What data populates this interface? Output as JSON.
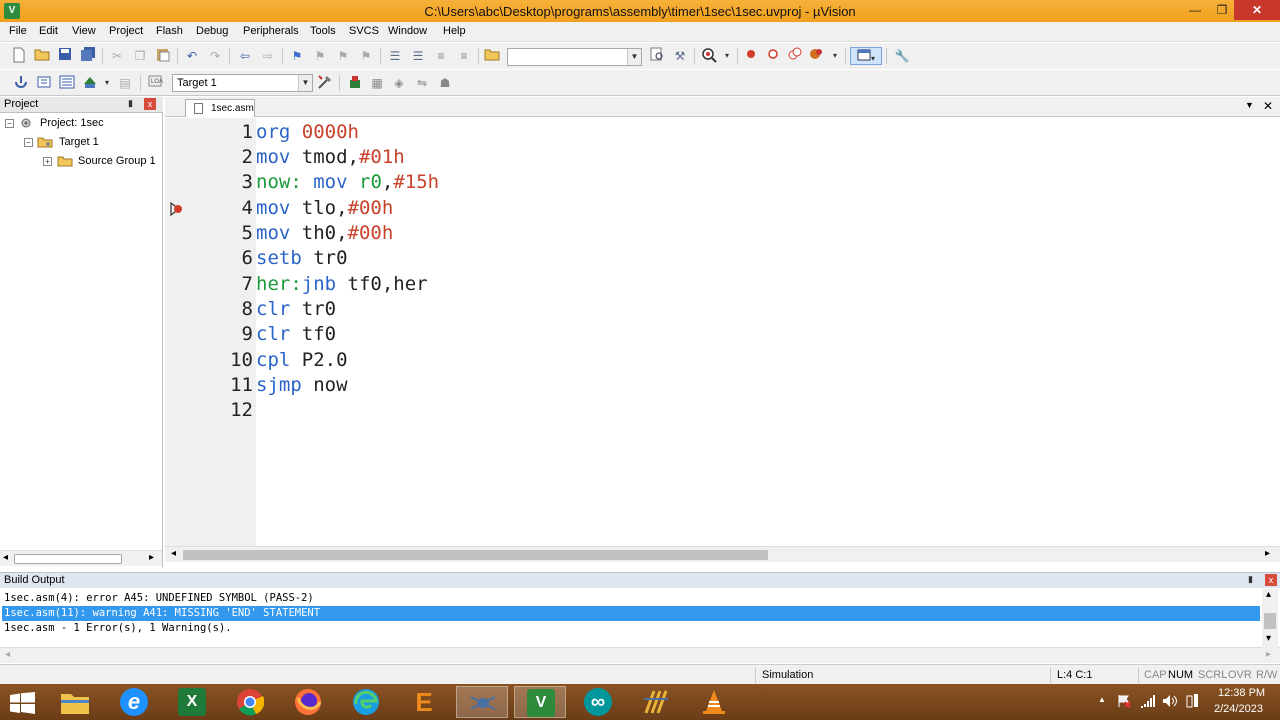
{
  "window": {
    "title": "C:\\Users\\abc\\Desktop\\programs\\assembly\\timer\\1sec\\1sec.uvproj - µVision",
    "app_icon": "V",
    "minimize": "—",
    "maximize": "❐",
    "close": "✕"
  },
  "menu": [
    "File",
    "Edit",
    "View",
    "Project",
    "Flash",
    "Debug",
    "Peripherals",
    "Tools",
    "SVCS",
    "Window",
    "Help"
  ],
  "toolbar2": {
    "target_select": "Target 1",
    "target_select_arrow": "▼"
  },
  "project_panel": {
    "title": "Project",
    "pin": "▮",
    "close": "x",
    "tree": [
      {
        "label": "Project: 1sec",
        "expander": "−",
        "icon": "project-gear-icon"
      },
      {
        "label": "Target 1",
        "expander": "−",
        "icon": "target-folder-icon"
      },
      {
        "label": "Source Group 1",
        "expander": "+",
        "icon": "folder-icon"
      }
    ],
    "scroll_left": "◂",
    "scroll_right": "▸"
  },
  "editor": {
    "tab_label": "1sec.asm",
    "dropdown": "▼",
    "close": "✕",
    "line_numbers": [
      "1",
      "2",
      "3",
      "4",
      "5",
      "6",
      "7",
      "8",
      "9",
      "10",
      "11",
      "12"
    ],
    "breakpoint_line": 4,
    "scroll_left": "◂",
    "scroll_right": "▸",
    "lines": [
      [
        {
          "t": "org",
          "c": "kw"
        },
        {
          "t": " ",
          "c": "plain"
        },
        {
          "t": "0000h",
          "c": "num"
        }
      ],
      [
        {
          "t": "mov",
          "c": "kw"
        },
        {
          "t": " tmod,",
          "c": "plain"
        },
        {
          "t": "#01h",
          "c": "num"
        }
      ],
      [
        {
          "t": "now:",
          "c": "lbl-green"
        },
        {
          "t": " ",
          "c": "plain"
        },
        {
          "t": "mov",
          "c": "kw"
        },
        {
          "t": " ",
          "c": "plain"
        },
        {
          "t": "r0",
          "c": "lbl-green"
        },
        {
          "t": ",",
          "c": "plain"
        },
        {
          "t": "#15h",
          "c": "num"
        }
      ],
      [
        {
          "t": "mov",
          "c": "kw"
        },
        {
          "t": " tlo,",
          "c": "plain"
        },
        {
          "t": "#00h",
          "c": "num"
        }
      ],
      [
        {
          "t": "mov",
          "c": "kw"
        },
        {
          "t": " th0,",
          "c": "plain"
        },
        {
          "t": "#00h",
          "c": "num"
        }
      ],
      [
        {
          "t": "setb",
          "c": "kw"
        },
        {
          "t": " tr0",
          "c": "plain"
        }
      ],
      [
        {
          "t": "her:",
          "c": "lbl-green"
        },
        {
          "t": "jnb",
          "c": "kw"
        },
        {
          "t": " tf0,her",
          "c": "plain"
        }
      ],
      [
        {
          "t": "clr",
          "c": "kw"
        },
        {
          "t": " tr0",
          "c": "plain"
        }
      ],
      [
        {
          "t": "clr",
          "c": "kw"
        },
        {
          "t": " tf0",
          "c": "plain"
        }
      ],
      [
        {
          "t": "cpl",
          "c": "kw"
        },
        {
          "t": " P2.0",
          "c": "plain"
        }
      ],
      [
        {
          "t": "sjmp",
          "c": "kw"
        },
        {
          "t": " now",
          "c": "plain"
        }
      ],
      []
    ]
  },
  "build_output": {
    "title": "Build Output",
    "pin": "▮",
    "close": "x",
    "lines": [
      "1sec.asm(4): error A45: UNDEFINED SYMBOL (PASS-2)",
      "1sec.asm(11): warning A41: MISSING 'END' STATEMENT",
      "1sec.asm - 1 Error(s), 1 Warning(s)."
    ],
    "selected_line": 1,
    "scroll_up": "▴",
    "scroll_down": "▾",
    "scroll_left": "◂",
    "scroll_right": "▸"
  },
  "status": {
    "mode": "Simulation",
    "cursor": "L:4 C:1",
    "caps": "CAP",
    "num": "NUM",
    "scrl": "SCRL",
    "ovr": "OVR",
    "rw": "R/W"
  },
  "taskbar": {
    "apps": [
      {
        "name": "start-button",
        "icon": "windows-logo-icon"
      },
      {
        "name": "file-explorer",
        "icon": "folder-icon"
      },
      {
        "name": "internet-explorer",
        "icon": "ie-icon",
        "glyph": "e"
      },
      {
        "name": "excel",
        "icon": "excel-icon",
        "glyph": "X"
      },
      {
        "name": "chrome",
        "icon": "chrome-icon"
      },
      {
        "name": "firefox",
        "icon": "firefox-icon"
      },
      {
        "name": "edge",
        "icon": "edge-icon"
      },
      {
        "name": "app-e",
        "icon": "e-app-icon",
        "glyph": "E"
      },
      {
        "name": "spider-app",
        "icon": "spider-icon"
      },
      {
        "name": "keil-uvision",
        "icon": "uvision-icon",
        "glyph": "V"
      },
      {
        "name": "arduino",
        "icon": "arduino-icon",
        "glyph": "∞"
      },
      {
        "name": "app-stripes",
        "icon": "stripes-icon"
      },
      {
        "name": "vlc",
        "icon": "vlc-cone-icon"
      }
    ],
    "time": "12:38 PM",
    "date": "2/24/2023",
    "tray_arrow": "▲"
  },
  "colors": {
    "titlebar": "#f5a623",
    "keyword": "#2b64c8",
    "number": "#c8412a",
    "label": "#1d9a3a",
    "selection": "#3399ee",
    "taskbar": "#7a4a1e"
  }
}
